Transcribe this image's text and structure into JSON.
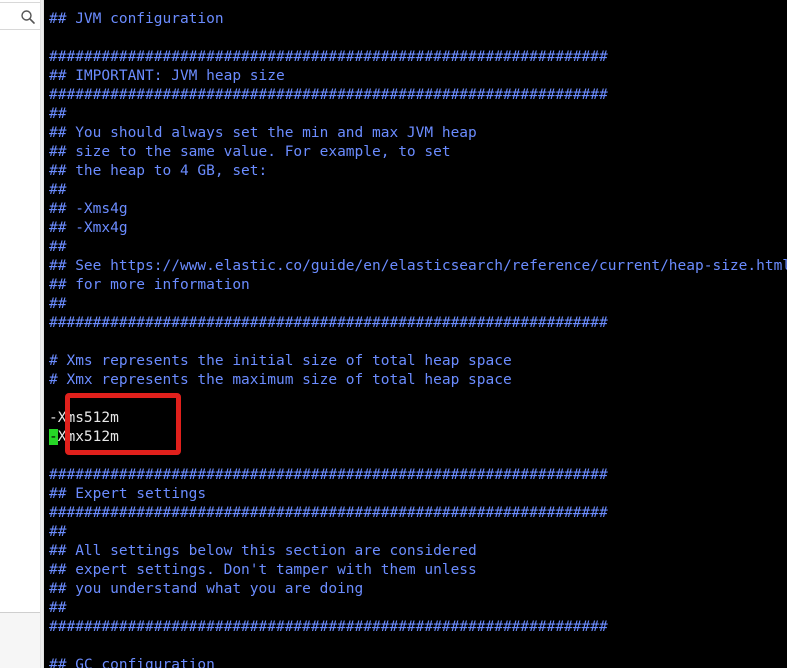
{
  "sidebar": {
    "search_icon": "search-icon"
  },
  "editor": {
    "colors": {
      "background": "#000000",
      "comment": "#6b8cff",
      "text": "#e8e8e8",
      "cursor": "#26d626",
      "annotation": "#e0201c"
    },
    "lines": [
      "## JVM configuration",
      "",
      "################################################################",
      "## IMPORTANT: JVM heap size",
      "################################################################",
      "##",
      "## You should always set the min and max JVM heap",
      "## size to the same value. For example, to set",
      "## the heap to 4 GB, set:",
      "##",
      "## -Xms4g",
      "## -Xmx4g",
      "##",
      "## See https://www.elastic.co/guide/en/elasticsearch/reference/current/heap-size.html",
      "## for more information",
      "##",
      "################################################################",
      "",
      "# Xms represents the initial size of total heap space",
      "# Xmx represents the maximum size of total heap space",
      "",
      "-Xms512m",
      "",
      "",
      "################################################################",
      "## Expert settings",
      "################################################################",
      "##",
      "## All settings below this section are considered",
      "## expert settings. Don't tamper with them unless",
      "## you understand what you are doing",
      "##",
      "################################################################",
      "",
      "## GC configuration"
    ],
    "cursor_line": {
      "cursor_char": "-",
      "rest": "Xmx512m"
    }
  }
}
